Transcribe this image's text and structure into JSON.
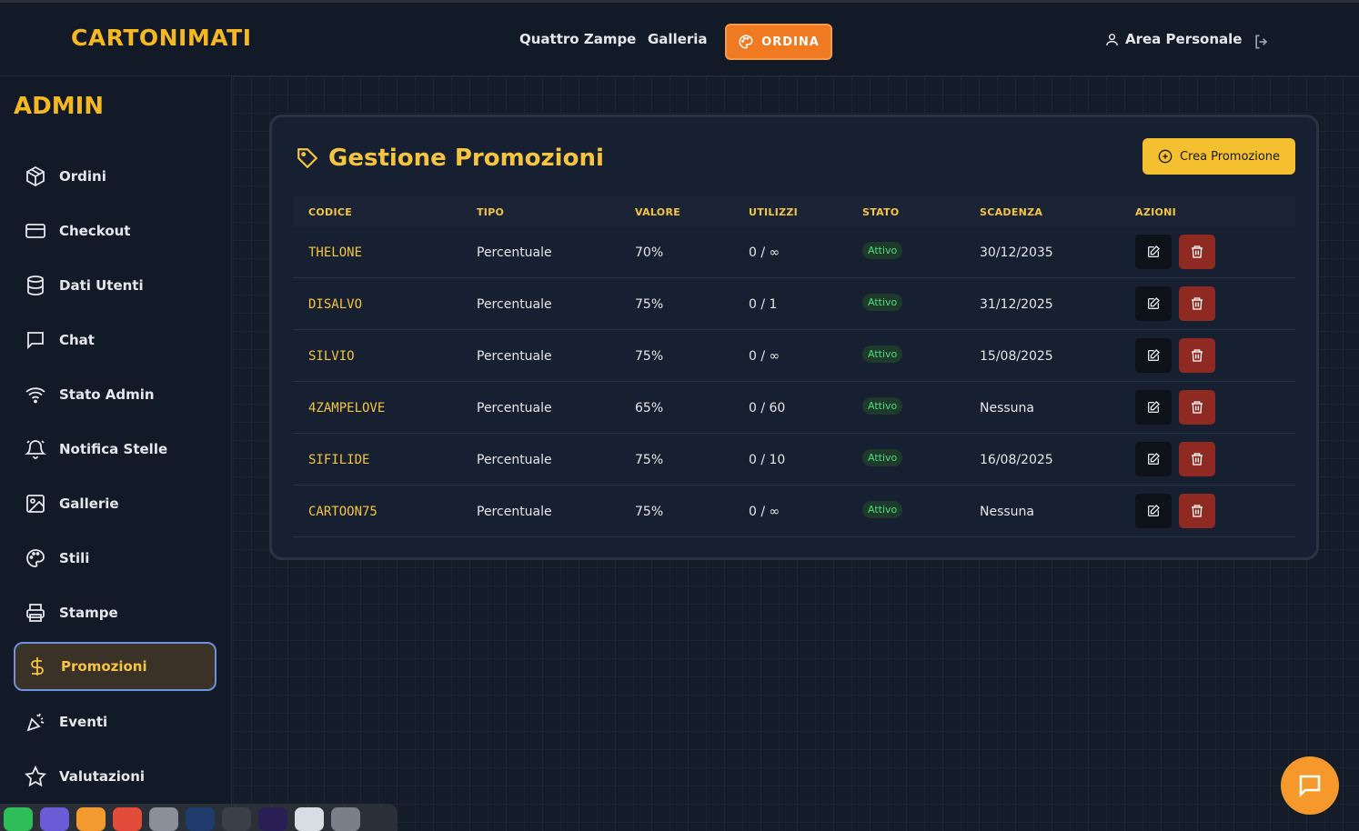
{
  "brand": {
    "logo": "CARTONIMATI"
  },
  "topnav": {
    "links": [
      "Quattro Zampe",
      "Galleria"
    ],
    "order_label": "ORDINA",
    "area_label": "Area Personale"
  },
  "sidebar": {
    "title": "ADMIN",
    "items": [
      {
        "label": "Ordini",
        "icon": "package-icon"
      },
      {
        "label": "Checkout",
        "icon": "credit-card-icon"
      },
      {
        "label": "Dati Utenti",
        "icon": "database-icon"
      },
      {
        "label": "Chat",
        "icon": "chat-icon"
      },
      {
        "label": "Stato Admin",
        "icon": "wifi-icon"
      },
      {
        "label": "Notifica Stelle",
        "icon": "bell-icon"
      },
      {
        "label": "Gallerie",
        "icon": "image-icon"
      },
      {
        "label": "Stili",
        "icon": "palette-icon"
      },
      {
        "label": "Stampe",
        "icon": "printer-icon"
      },
      {
        "label": "Promozioni",
        "icon": "dollar-icon",
        "active": true
      },
      {
        "label": "Eventi",
        "icon": "party-icon"
      },
      {
        "label": "Valutazioni",
        "icon": "star-icon"
      }
    ]
  },
  "main": {
    "title": "Gestione Promozioni",
    "create_label": "Crea Promozione",
    "columns": [
      "CODICE",
      "TIPO",
      "VALORE",
      "UTILIZZI",
      "STATO",
      "SCADENZA",
      "AZIONI"
    ],
    "rows": [
      {
        "code": "THELONE",
        "type": "Percentuale",
        "value": "70%",
        "uses": "0 / ∞",
        "status": "Attivo",
        "expiry": "30/12/2035"
      },
      {
        "code": "DISALVO",
        "type": "Percentuale",
        "value": "75%",
        "uses": "0 / 1",
        "status": "Attivo",
        "expiry": "31/12/2025"
      },
      {
        "code": "SILVIO",
        "type": "Percentuale",
        "value": "75%",
        "uses": "0 / ∞",
        "status": "Attivo",
        "expiry": "15/08/2025"
      },
      {
        "code": "4ZAMPELOVE",
        "type": "Percentuale",
        "value": "65%",
        "uses": "0 / 60",
        "status": "Attivo",
        "expiry": "Nessuna"
      },
      {
        "code": "SIFILIDE",
        "type": "Percentuale",
        "value": "75%",
        "uses": "0 / 10",
        "status": "Attivo",
        "expiry": "16/08/2025"
      },
      {
        "code": "CARTOON75",
        "type": "Percentuale",
        "value": "75%",
        "uses": "0 / ∞",
        "status": "Attivo",
        "expiry": "Nessuna"
      }
    ]
  },
  "colors": {
    "accent": "#f5c542",
    "order": "#ef7a22",
    "delete": "#8f2a23",
    "active_badge": "#4ade80"
  }
}
